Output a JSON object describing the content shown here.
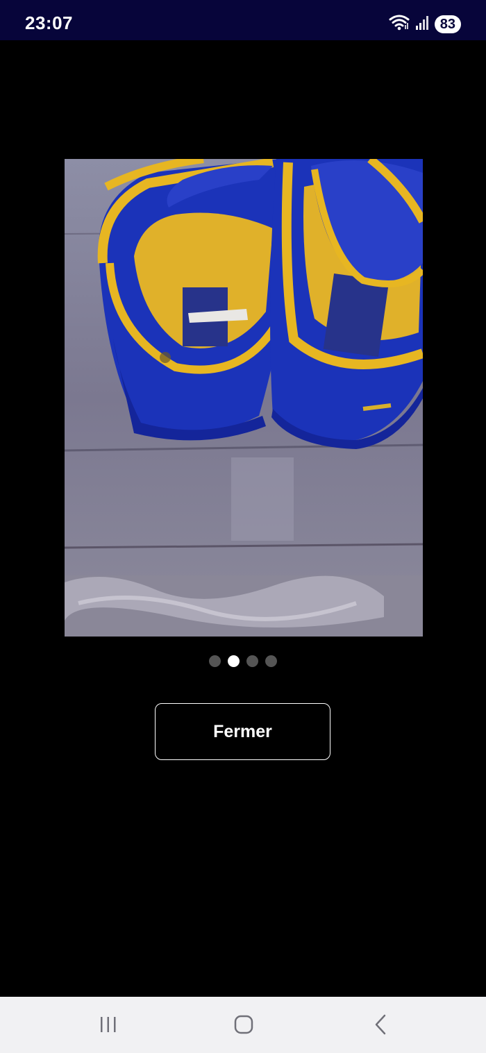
{
  "status_bar": {
    "time": "23:07",
    "battery": "83",
    "icons": [
      "wifi-icon",
      "signal-icon",
      "battery-icon"
    ],
    "background": "#07053a"
  },
  "viewer": {
    "photo_description_icon": "photo-shoes",
    "pager": {
      "total": 4,
      "active_index": 1
    },
    "close_label": "Fermer"
  },
  "nav_bar": {
    "buttons": [
      "recent-apps-icon",
      "home-icon",
      "back-icon"
    ]
  }
}
